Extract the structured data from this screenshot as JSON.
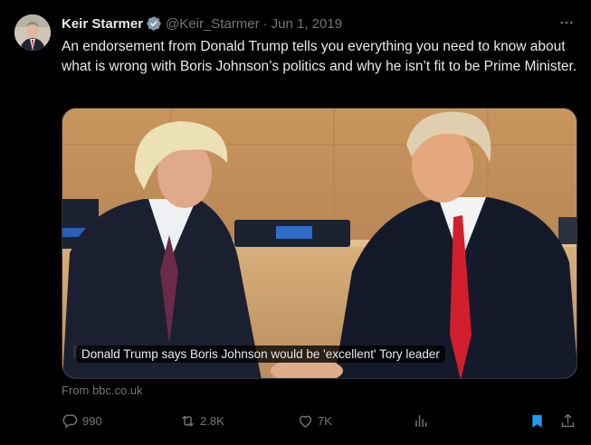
{
  "author": {
    "name": "Keir Starmer",
    "handle": "@Keir_Starmer",
    "separator": "·",
    "date": "Jun 1, 2019",
    "verified_icon": "verified-badge-icon"
  },
  "tweet": {
    "text": "An endorsement from Donald Trump tells you everything you need to know about what is wrong with Boris Johnson’s politics and why he isn’t fit to be Prime Minister."
  },
  "card": {
    "caption": "Donald Trump says Boris Johnson would be 'excellent' Tory leader",
    "source": "From bbc.co.uk"
  },
  "actions": {
    "replies": "990",
    "retweets": "2.8K",
    "likes": "7K",
    "views": "",
    "icons": [
      "reply-icon",
      "retweet-icon",
      "like-icon",
      "views-icon",
      "bookmark-icon",
      "share-icon"
    ]
  },
  "colors": {
    "background": "#000000",
    "text": "#e7e9ea",
    "muted": "#71767b",
    "bookmark": "#1d9bf0",
    "verified": "#829aab"
  }
}
